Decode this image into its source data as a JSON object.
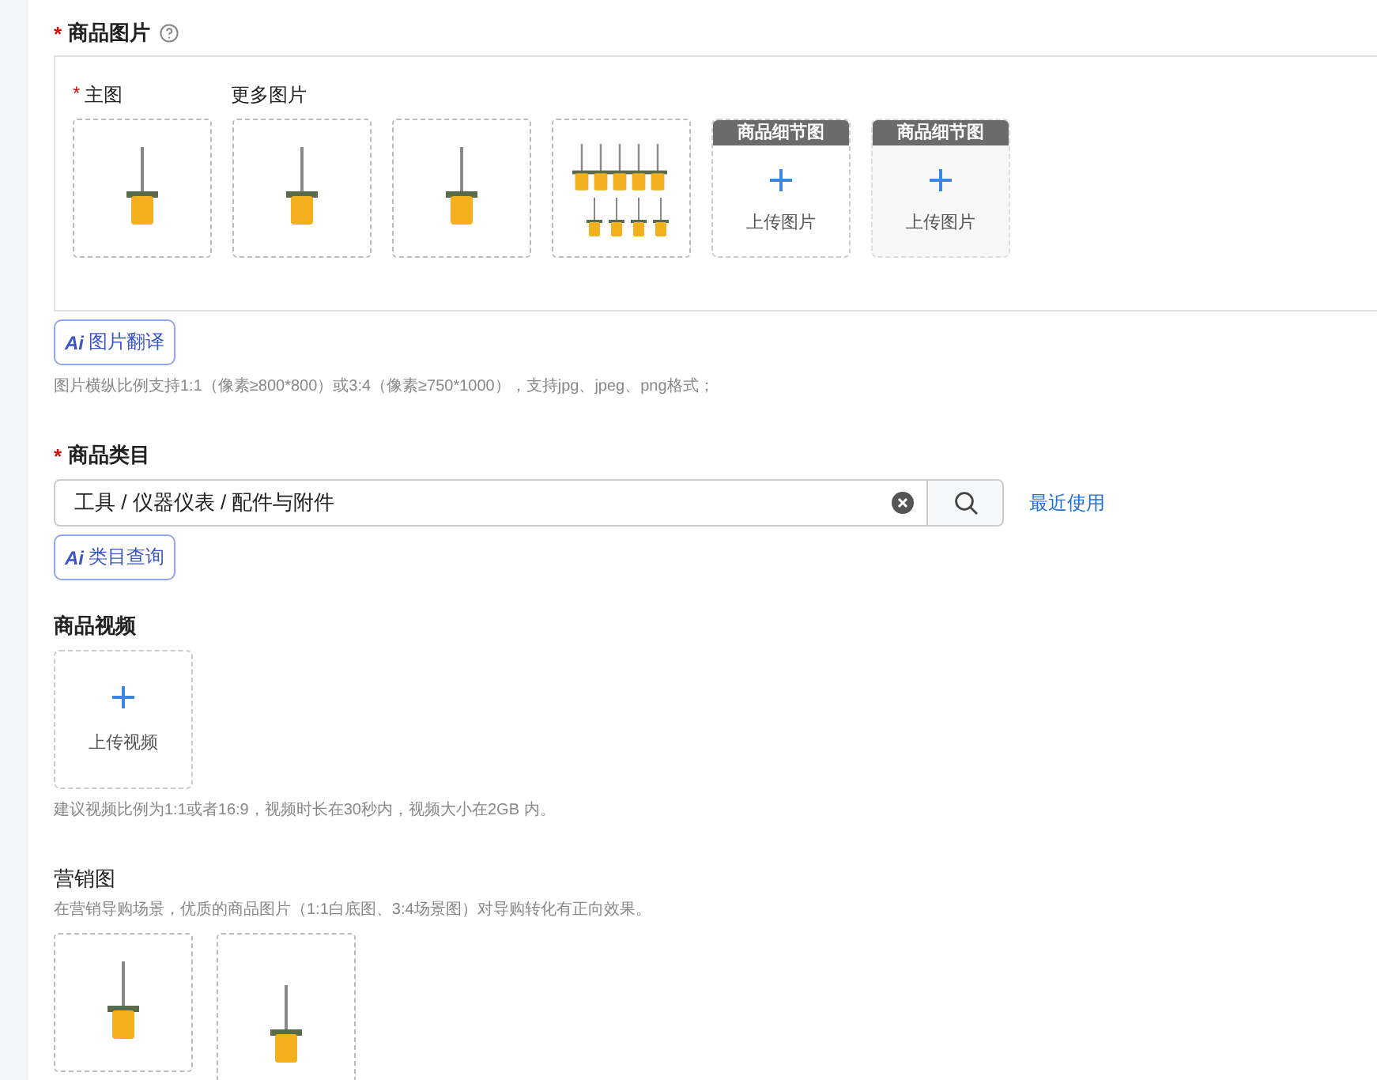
{
  "images_section": {
    "required_mark": "*",
    "label": "商品图片",
    "main_required_mark": "*",
    "main_label": "主图",
    "more_label": "更多图片",
    "tiles": [
      {
        "kind": "photo"
      },
      {
        "kind": "photo"
      },
      {
        "kind": "photo"
      },
      {
        "kind": "collage"
      },
      {
        "kind": "upload",
        "header": "商品细节图",
        "text": "上传图片",
        "shaded": false
      },
      {
        "kind": "upload",
        "header": "商品细节图",
        "text": "上传图片",
        "shaded": true
      }
    ],
    "ai_button": {
      "badge": "Ai",
      "label": "图片翻译"
    },
    "hint": "图片横纵比例支持1:1（像素≥800*800）或3:4（像素≥750*1000），支持jpg、jpeg、png格式；"
  },
  "category_section": {
    "required_mark": "*",
    "label": "商品类目",
    "value": "工具 / 仪器仪表 / 配件与附件",
    "recent_link": "最近使用",
    "ai_button": {
      "badge": "Ai",
      "label": "类目查询"
    }
  },
  "video_section": {
    "label": "商品视频",
    "upload_text": "上传视频",
    "hint": "建议视频比例为1:1或者16:9，视频时长在30秒内，视频大小在2GB 内。"
  },
  "marketing_section": {
    "label": "营销图",
    "hint": "在营销导购场景，优质的商品图片（1:1白底图、3:4场景图）对导购转化有正向效果。",
    "images": [
      {
        "kind": "square"
      },
      {
        "kind": "portrait"
      }
    ]
  }
}
